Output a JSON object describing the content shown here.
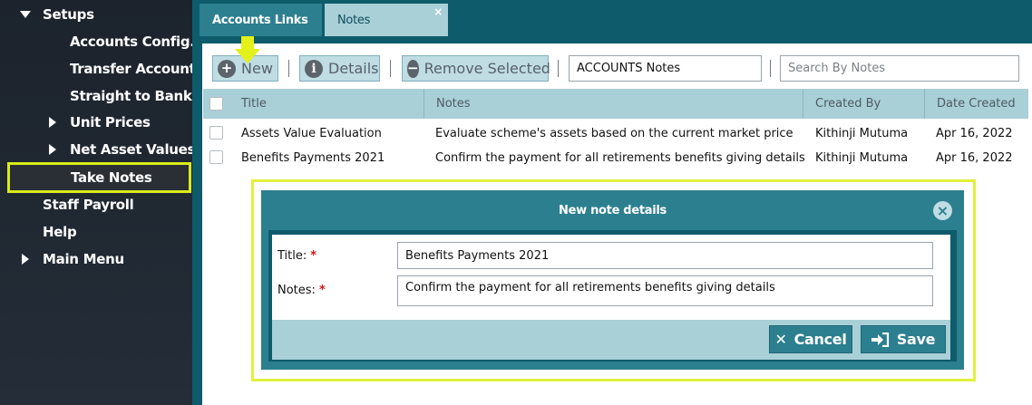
{
  "sidebar": {
    "items": [
      {
        "label": "Setups",
        "caret": "down"
      },
      {
        "label": "Accounts Config..."
      },
      {
        "label": "Transfer Account..."
      },
      {
        "label": "Straight to Bank ..."
      },
      {
        "label": "Unit Prices",
        "caret": "right"
      },
      {
        "label": "Net Asset Values",
        "caret": "right"
      },
      {
        "label": "Take Notes",
        "active": true
      },
      {
        "label": "Staff Payroll"
      },
      {
        "label": "Help"
      },
      {
        "label": "Main Menu",
        "caret": "right"
      }
    ]
  },
  "tabs": [
    {
      "label": "Accounts Links"
    },
    {
      "label": "Notes",
      "close": "×"
    }
  ],
  "toolbar": {
    "new_label": "New",
    "details_label": "Details",
    "remove_label": "Remove Selected",
    "notebook_value": "ACCOUNTS Notes",
    "search_placeholder": "Search By Notes"
  },
  "table": {
    "columns": [
      "Title",
      "Notes",
      "Created By",
      "Date Created"
    ],
    "rows": [
      {
        "title": "Assets Value Evaluation",
        "notes": "Evaluate scheme's assets based on the current market price",
        "created_by": "Kithinji Mutuma",
        "date": "Apr 16, 2022"
      },
      {
        "title": "Benefits Payments 2021",
        "notes": "Confirm the payment for all retirements benefits giving details",
        "created_by": "Kithinji Mutuma",
        "date": "Apr 16, 2022"
      }
    ]
  },
  "modal": {
    "title": "New note details",
    "title_label": "Title:",
    "notes_label": "Notes:",
    "required_mark": "*",
    "title_value": "Benefits Payments 2021",
    "notes_value": "Confirm the payment for all retirements benefits giving details",
    "cancel_label": "Cancel",
    "save_label": "Save"
  },
  "colors": {
    "sidebar_bg": "#1c232c",
    "teal_dark": "#0d5b6b",
    "teal": "#2c7f8f",
    "teal_light": "#a9cfd7",
    "highlight": "#d9ec1a",
    "required": "#d21414"
  },
  "icons": {
    "new": "plus-circle-icon",
    "details": "info-circle-icon",
    "remove": "minus-circle-icon",
    "cancel": "x-icon",
    "save": "sign-in-arrow-icon",
    "modal_close": "close-circle-icon",
    "marker": "down-arrow-marker-icon"
  }
}
